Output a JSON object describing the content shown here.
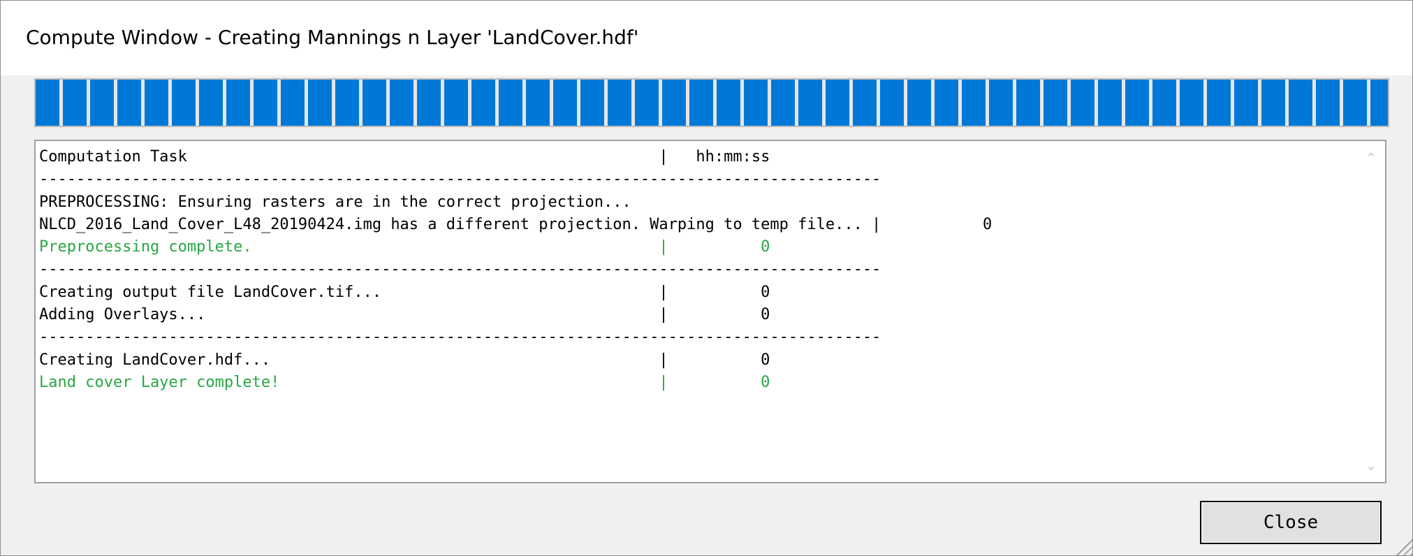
{
  "window": {
    "title": "Compute Window - Creating Mannings n Layer 'LandCover.hdf'"
  },
  "progress": {
    "value": 1.0
  },
  "log": {
    "lines": [
      {
        "text": "Computation Task                                                   |   hh:mm:ss",
        "style": "normal"
      },
      {
        "text": "-------------------------------------------------------------------------------------------",
        "style": "sep"
      },
      {
        "text": "PREPROCESSING: Ensuring rasters are in the correct projection...",
        "style": "normal"
      },
      {
        "text": "NLCD_2016_Land_Cover_L48_20190424.img has a different projection. Warping to temp file... |           0",
        "style": "normal"
      },
      {
        "text": "Preprocessing complete.                                            |          0",
        "style": "ok"
      },
      {
        "text": "-------------------------------------------------------------------------------------------",
        "style": "sep"
      },
      {
        "text": "Creating output file LandCover.tif...                              |          0",
        "style": "normal"
      },
      {
        "text": "Adding Overlays...                                                 |          0",
        "style": "normal"
      },
      {
        "text": "-------------------------------------------------------------------------------------------",
        "style": "sep"
      },
      {
        "text": "Creating LandCover.hdf...                                          |          0",
        "style": "normal"
      },
      {
        "text": "Land cover Layer complete!                                         |          0",
        "style": "ok"
      }
    ],
    "colors": {
      "normal": "#000000",
      "ok": "#28a745"
    },
    "scroll_up_icon": "chevron-up-icon",
    "scroll_down_icon": "chevron-down-icon"
  },
  "buttons": {
    "close_label": "Close"
  },
  "colors": {
    "progress_fill": "#0078d7",
    "window_bg": "#f0f0f0"
  }
}
